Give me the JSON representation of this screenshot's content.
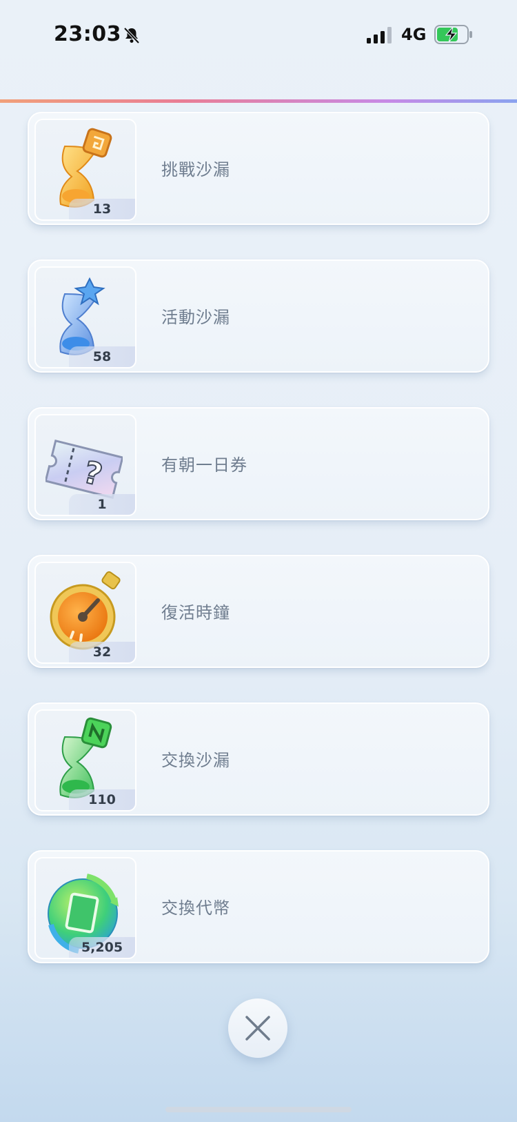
{
  "status_bar": {
    "time": "23:03",
    "network": "4G"
  },
  "items": [
    {
      "name": "挑戰沙漏",
      "quantity": "13",
      "icon": "orange-hourglass-icon"
    },
    {
      "name": "活動沙漏",
      "quantity": "58",
      "icon": "blue-hourglass-icon"
    },
    {
      "name": "有朝一日券",
      "quantity": "1",
      "icon": "mystery-ticket-icon"
    },
    {
      "name": "復活時鐘",
      "quantity": "32",
      "icon": "stopwatch-icon"
    },
    {
      "name": "交換沙漏",
      "quantity": "110",
      "icon": "green-hourglass-icon"
    },
    {
      "name": "交換代幣",
      "quantity": "5,205",
      "icon": "exchange-token-icon"
    }
  ],
  "colors": {
    "accent_gradient": [
      "#f1a07a",
      "#c78ae6",
      "#8aa3ef"
    ],
    "label_text": "#6f7d8f"
  }
}
